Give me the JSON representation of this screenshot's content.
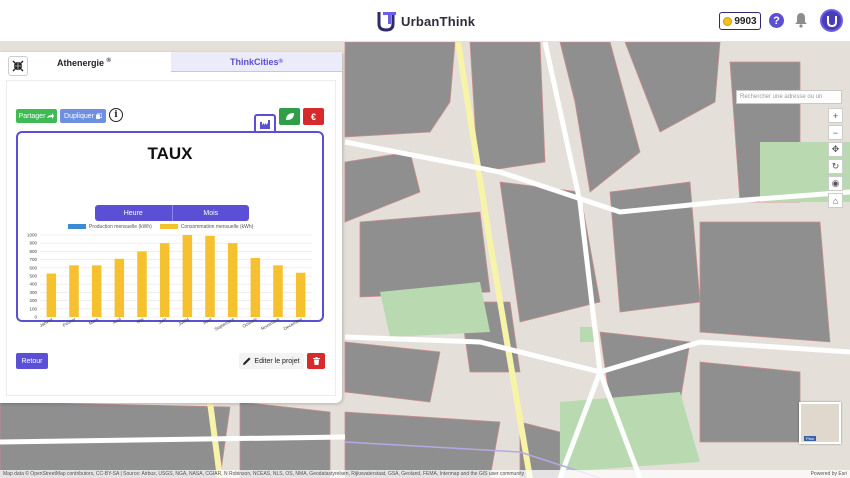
{
  "header": {
    "brand": "UrbanThink",
    "coins": "9903",
    "help_symbol": "?"
  },
  "map": {
    "search_placeholder": "Rechercher une adresse ou un",
    "attribution": "Map data © OpenStreetMap contributors, CC-BY-SA | Source: Airbus, USGS, NGA, NASA, CGIAR, N Robinson, NCEAS, NLS, OS, NMA, Geodatastyrelsen, Rijkswaterstaat, GSA, Geoland, FEMA, Intermap and the GIS user community",
    "powered_by": "Powered by Esri",
    "minimap_label": "Plan",
    "tools": [
      "+",
      "−",
      "✥",
      "↻",
      "◉",
      "⌂"
    ]
  },
  "panel": {
    "tabs": [
      {
        "label": "Athenergie",
        "mark": "®",
        "active": true
      },
      {
        "label": "ThinkCities",
        "mark": "®",
        "active": false
      }
    ],
    "share_label": "Partager",
    "duplicate_label": "Dupliquer",
    "info_symbol": "i",
    "euro_symbol": "€",
    "back_label": "Retour",
    "edit_label": "Editer le projet",
    "colors": {
      "accent": "#5b4fd6",
      "green": "#2f9e46",
      "red": "#d82a2a",
      "bar": "#f5c12e",
      "production": "#3a8ad4"
    }
  },
  "chart_data": {
    "type": "bar",
    "title": "TAUX",
    "toggle": [
      "Heure",
      "Mois"
    ],
    "categories": [
      "Janvier",
      "Fevrier",
      "Mars",
      "Avril",
      "Mai",
      "Juin",
      "Juillet",
      "Aout",
      "Septembre",
      "Octobre",
      "Novembre",
      "Decembre"
    ],
    "series": [
      {
        "name": "Production mensuelle (kWh)",
        "color": "#3a8ad4",
        "values": [
          0,
          0,
          0,
          0,
          0,
          0,
          0,
          0,
          0,
          0,
          0,
          0
        ]
      },
      {
        "name": "Consommation mensuelle (kWh)",
        "color": "#f5c12e",
        "values": [
          530,
          630,
          630,
          710,
          800,
          900,
          1000,
          990,
          900,
          720,
          630,
          540
        ]
      }
    ],
    "yticks": [
      0,
      100,
      200,
      300,
      400,
      500,
      600,
      700,
      800,
      900,
      1000
    ],
    "ylim": [
      0,
      1000
    ],
    "grid": true,
    "legend": "top"
  }
}
